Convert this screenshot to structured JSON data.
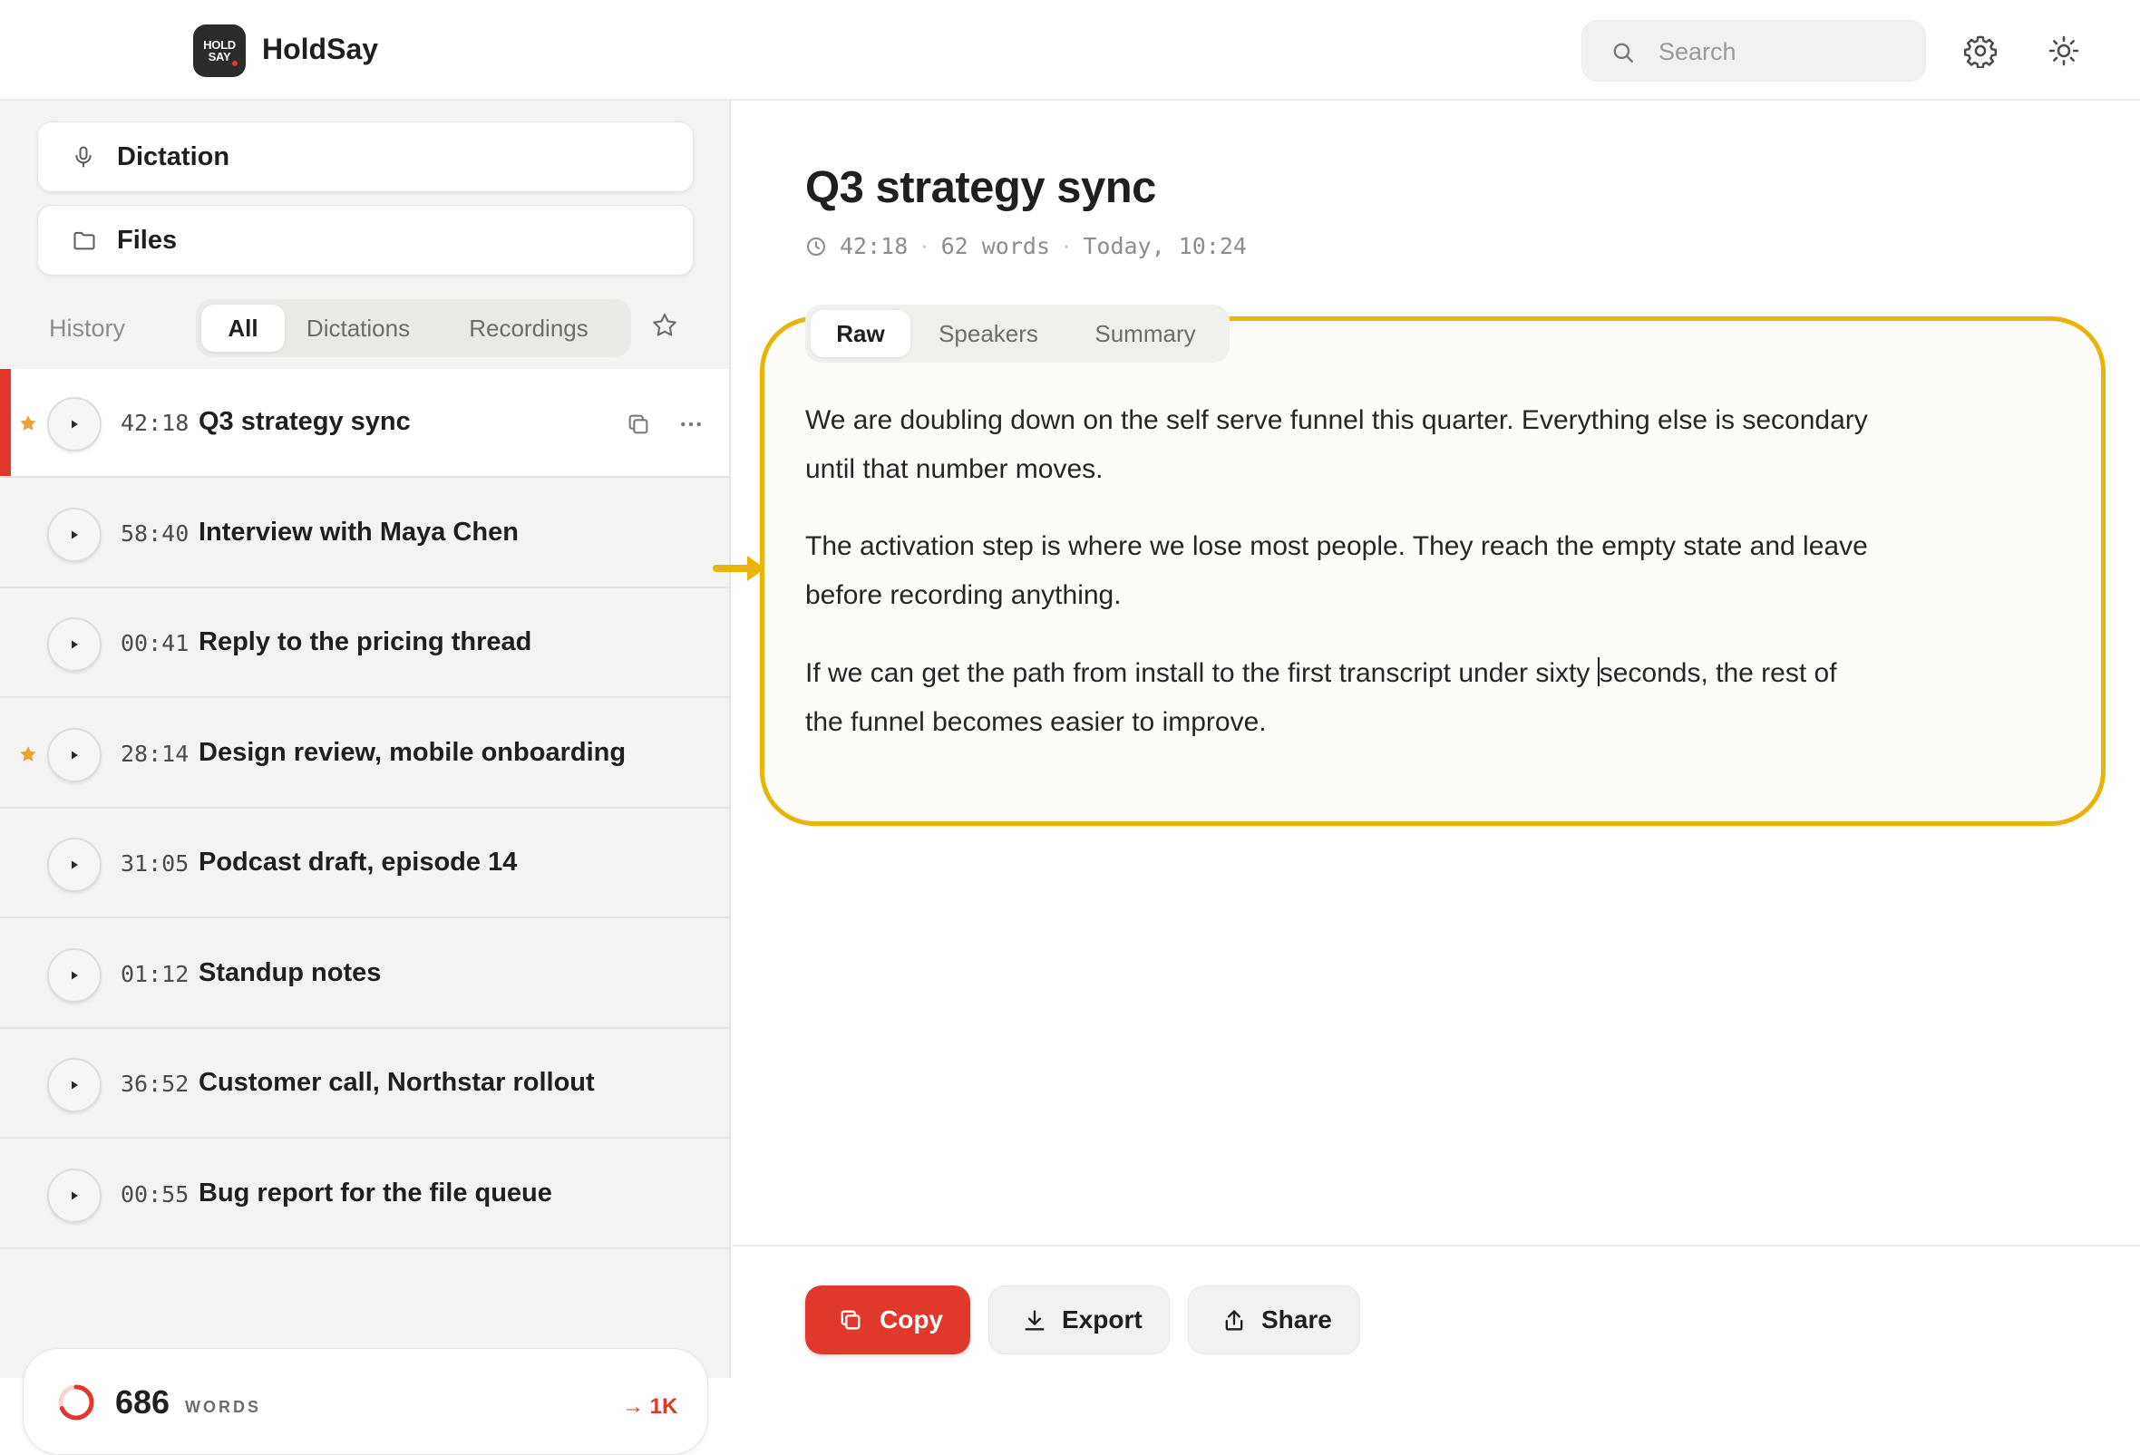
{
  "app": {
    "name": "HoldSay",
    "logo_line1": "HOLD",
    "logo_line2": "SAY"
  },
  "search": {
    "placeholder": "Search"
  },
  "toolbar": {
    "settings_icon": "gear-icon",
    "theme_icon": "sun-icon"
  },
  "sidebar": {
    "nav": [
      {
        "label": "Dictation",
        "icon": "microphone-icon"
      },
      {
        "label": "Files",
        "icon": "folder-icon"
      }
    ],
    "history_label": "History",
    "filters": [
      {
        "label": "All",
        "active": true
      },
      {
        "label": "Dictations",
        "active": false
      },
      {
        "label": "Recordings",
        "active": false
      }
    ],
    "history": [
      {
        "duration": "42:18",
        "title": "Q3 strategy sync",
        "starred": true,
        "selected": true
      },
      {
        "duration": "58:40",
        "title": "Interview with Maya Chen",
        "starred": false,
        "selected": false
      },
      {
        "duration": "00:41",
        "title": "Reply to the pricing thread",
        "starred": false,
        "selected": false
      },
      {
        "duration": "28:14",
        "title": "Design review, mobile onboarding",
        "starred": true,
        "selected": false
      },
      {
        "duration": "31:05",
        "title": "Podcast draft, episode 14",
        "starred": false,
        "selected": false
      },
      {
        "duration": "01:12",
        "title": "Standup notes",
        "starred": false,
        "selected": false
      },
      {
        "duration": "36:52",
        "title": "Customer call, Northstar rollout",
        "starred": false,
        "selected": false
      },
      {
        "duration": "00:55",
        "title": "Bug report for the file queue",
        "starred": false,
        "selected": false
      }
    ],
    "word_stats": {
      "count": "686",
      "unit": "WORDS",
      "goal": "→ 1K",
      "progress": 0.686,
      "accent": "#e0382b"
    }
  },
  "document": {
    "title": "Q3 strategy sync",
    "duration": "42:18",
    "words": "62 words",
    "date": "Today, 10:24",
    "separator": "·",
    "tabs": [
      {
        "label": "Raw",
        "active": true
      },
      {
        "label": "Speakers",
        "active": false
      },
      {
        "label": "Summary",
        "active": false
      }
    ],
    "paragraphs": [
      {
        "text": "We are doubling down on the self serve funnel this quarter. Everything else is secondary until that number moves."
      },
      {
        "text": "The activation step is where we lose most people. They reach the empty state and leave before recording anything."
      },
      {
        "before_caret": "If we can get the path from install to the first transcript under sixty ",
        "after_caret": "seconds, the rest of the funnel becomes easier to improve."
      }
    ],
    "highlight_color": "#eab308"
  },
  "actions": {
    "copy": "Copy",
    "export": "Export",
    "share": "Share"
  },
  "colors": {
    "accent": "#e0382b",
    "highlight": "#eab308",
    "star": "#e8a33b"
  }
}
